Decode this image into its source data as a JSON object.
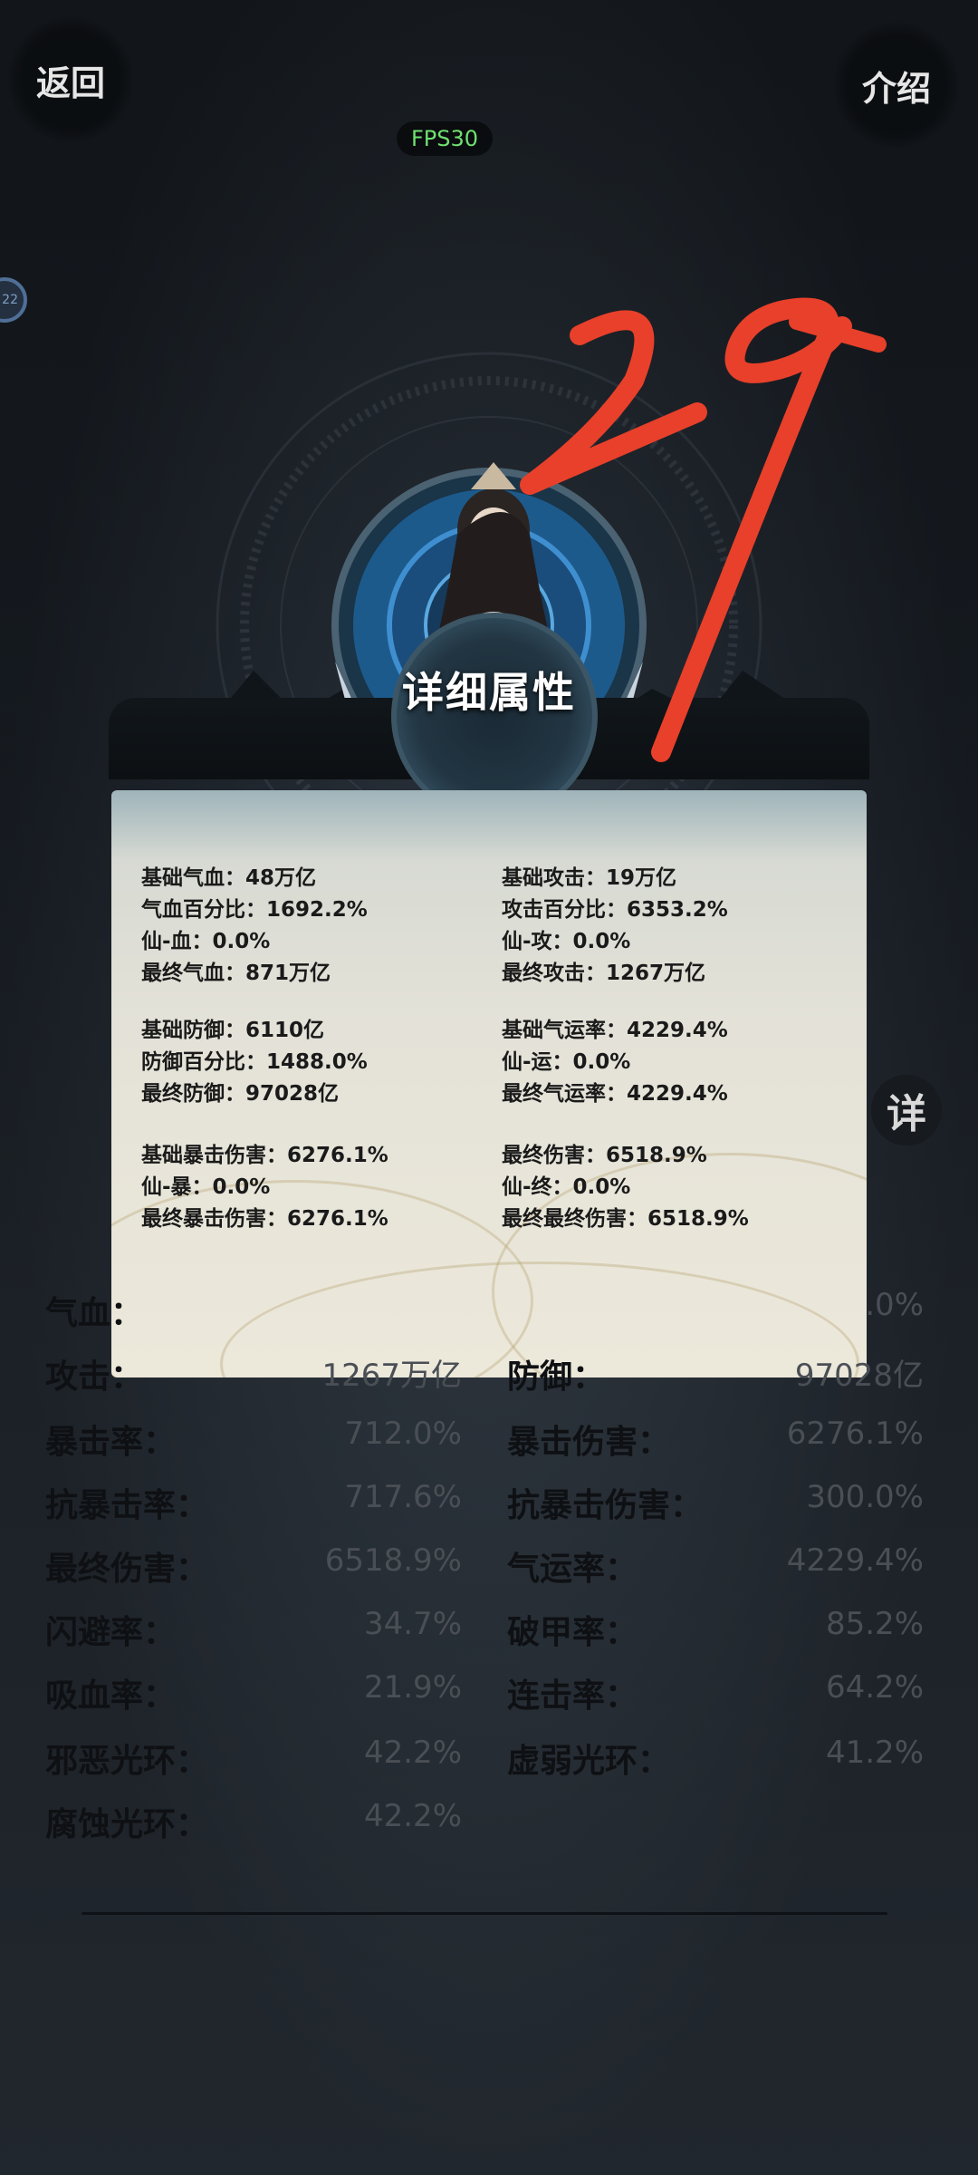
{
  "nav": {
    "back_label": "返回",
    "intro_label": "介绍"
  },
  "fps_label": "FPS30",
  "side_badge_text": "22",
  "side_detail_label": "详",
  "panel": {
    "title": "详细属性",
    "groups": [
      {
        "col": "left",
        "lines": [
          "基础气血：48万亿",
          "气血百分比：1692.2%",
          "仙-血：0.0%",
          "最终气血：871万亿"
        ]
      },
      {
        "col": "right",
        "lines": [
          "基础攻击：19万亿",
          "攻击百分比：6353.2%",
          "仙-攻：0.0%",
          "最终攻击：1267万亿"
        ]
      },
      {
        "col": "left",
        "lines": [
          "基础防御：6110亿",
          "防御百分比：1488.0%",
          "最终防御：97028亿"
        ]
      },
      {
        "col": "right",
        "lines": [
          "基础气运率：4229.4%",
          "仙-运：0.0%",
          "最终气运率：4229.4%"
        ]
      },
      {
        "col": "left",
        "lines": [
          "基础暴击伤害：6276.1%",
          "仙-暴：0.0%",
          "最终暴击伤害：6276.1%"
        ]
      },
      {
        "col": "right",
        "lines": [
          "最终伤害：6518.9%",
          "仙-终：0.0%",
          "最终最终伤害：6518.9%"
        ]
      }
    ]
  },
  "stats": [
    {
      "label": "气血：",
      "value": ""
    },
    {
      "label": "",
      "value": ".0%"
    },
    {
      "label": "攻击：",
      "value": "1267万亿"
    },
    {
      "label": "防御：",
      "value": "97028亿"
    },
    {
      "label": "暴击率：",
      "value": "712.0%"
    },
    {
      "label": "暴击伤害：",
      "value": "6276.1%"
    },
    {
      "label": "抗暴击率：",
      "value": "717.6%"
    },
    {
      "label": "抗暴击伤害：",
      "value": "300.0%"
    },
    {
      "label": "最终伤害：",
      "value": "6518.9%"
    },
    {
      "label": "气运率：",
      "value": "4229.4%"
    },
    {
      "label": "闪避率：",
      "value": "34.7%"
    },
    {
      "label": "破甲率：",
      "value": "85.2%"
    },
    {
      "label": "吸血率：",
      "value": "21.9%"
    },
    {
      "label": "连击率：",
      "value": "64.2%"
    },
    {
      "label": "邪恶光环：",
      "value": "42.2%"
    },
    {
      "label": "虚弱光环：",
      "value": "41.2%"
    },
    {
      "label": "腐蚀光环：",
      "value": "42.2%"
    }
  ],
  "annotation_text": "29",
  "colors": {
    "annotation": "#e8402a",
    "fps": "#6fe06f",
    "accent_ring": "#2b6ea8"
  },
  "icons": {
    "character": "character-portrait-icon",
    "crane": "crane-icon"
  }
}
